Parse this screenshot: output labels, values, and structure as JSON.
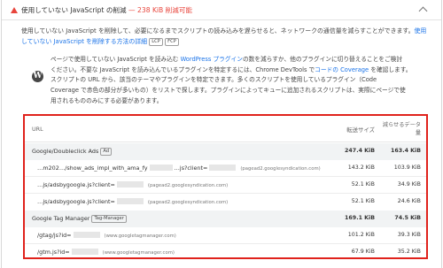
{
  "audit": {
    "title": "使用していない JavaScript の削減",
    "separator": " — ",
    "savings": "238 KiB 削減可能"
  },
  "description": {
    "text_before": "使用していない JavaScript を削除して、必要になるまでスクリプトの読み込みを遅らせると、ネットワークの通信量を減らすことができます。",
    "link": "使用していない JavaScript を削除する方法の詳細",
    "tag1": "LCP",
    "tag2": "FCP"
  },
  "wordpress": {
    "logo": "W",
    "line1_a": "ページで使用していない JavaScript を読み込む ",
    "line1_link": "WordPress プラグイン",
    "line1_b": "の数を減らすか、他のプラグインに切り替えることをご検討",
    "line2_a": "ください。不要な JavaScript を読み込んでいるプラグインを特定するには、Chrome DevTools で",
    "line2_link": "コードの Coverage",
    "line2_b": " を確認します。",
    "line3": "スクリプトの URL から、該当のテーマやプラグインを特定できます。多くのスクリプトを使用しているプラグイン（Code",
    "line4": "Coverage で赤色の部分が多いもの）をリストで探します。プラグインによってキューに追加されるスクリプトは、実際にページで使",
    "line5": "用されるもののみにする必要があります。"
  },
  "table": {
    "headers": {
      "url": "URL",
      "size": "転送サイズ",
      "savings": "減らせるデータ量"
    },
    "rows": [
      {
        "type": "group",
        "url": "Google/Doubleclick Ads",
        "tag": "Ad",
        "size": "247.4 KiB",
        "savings": "163.4 KiB"
      },
      {
        "type": "sub",
        "url_a": "…m202…/show_ads_impl_with_ama_fy",
        "url_b": "…js?client=",
        "origin": "(pagead2.googlesyndication.com)",
        "size": "143.2 KiB",
        "savings": "103.9 KiB"
      },
      {
        "type": "sub",
        "url_a": "…js/adsbygoogle.js?client=",
        "url_b": "",
        "origin": "(pagead2.googlesyndication.com)",
        "size": "52.1 KiB",
        "savings": "34.9 KiB"
      },
      {
        "type": "sub",
        "url_a": "…js/adsbygoogle.js?client=",
        "url_b": "",
        "origin": "(pagead2.googlesyndication.com)",
        "size": "52.1 KiB",
        "savings": "24.6 KiB"
      },
      {
        "type": "group",
        "url": "Google Tag Manager",
        "tag": "Tag-Manager",
        "size": "169.1 KiB",
        "savings": "74.5 KiB"
      },
      {
        "type": "sub",
        "url_a": "/gtag/js?id=",
        "url_b": "",
        "origin": "(www.googletagmanager.com)",
        "size": "101.2 KiB",
        "savings": "39.3 KiB"
      },
      {
        "type": "sub",
        "url_a": "/gtm.js?id=",
        "url_b": "",
        "origin": "(www.googletagmanager.com)",
        "size": "67.9 KiB",
        "savings": "35.2 KiB"
      }
    ]
  },
  "colors": {
    "warning": "#e8453c",
    "link": "#1a73e8",
    "highlight_border": "#e0221c"
  },
  "icons": {
    "warning": "warning-triangle-icon",
    "expand": "chevron-up-icon",
    "logo": "wordpress-logo-icon"
  }
}
